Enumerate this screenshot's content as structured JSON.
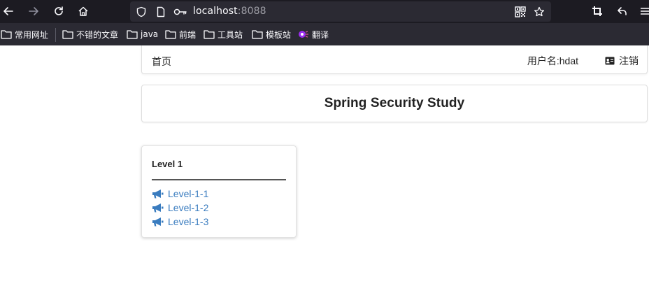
{
  "browser": {
    "url_host": "localhost",
    "url_port": ":8088",
    "bookmarks": [
      {
        "label": "常用网址",
        "icon": "folder-icon"
      },
      {
        "label": "不错的文章",
        "icon": "folder-icon"
      },
      {
        "label": "java",
        "icon": "folder-icon"
      },
      {
        "label": "前端",
        "icon": "folder-icon"
      },
      {
        "label": "工具站",
        "icon": "folder-icon"
      },
      {
        "label": "模板站",
        "icon": "folder-icon"
      },
      {
        "label": "翻译",
        "icon": "translate-icon"
      }
    ]
  },
  "nav": {
    "home": "首页",
    "user": "用户名:hdat",
    "logout": "注销"
  },
  "header": {
    "title": "Spring Security Study"
  },
  "card": {
    "title": "Level 1",
    "links": [
      "Level-1-1",
      "Level-1-2",
      "Level-1-3"
    ],
    "link_icon": "bullhorn-icon"
  },
  "colors": {
    "link": "#3a7cbf",
    "chrome_dark": "#1c1b22",
    "chrome_bar": "#2b2a33"
  }
}
